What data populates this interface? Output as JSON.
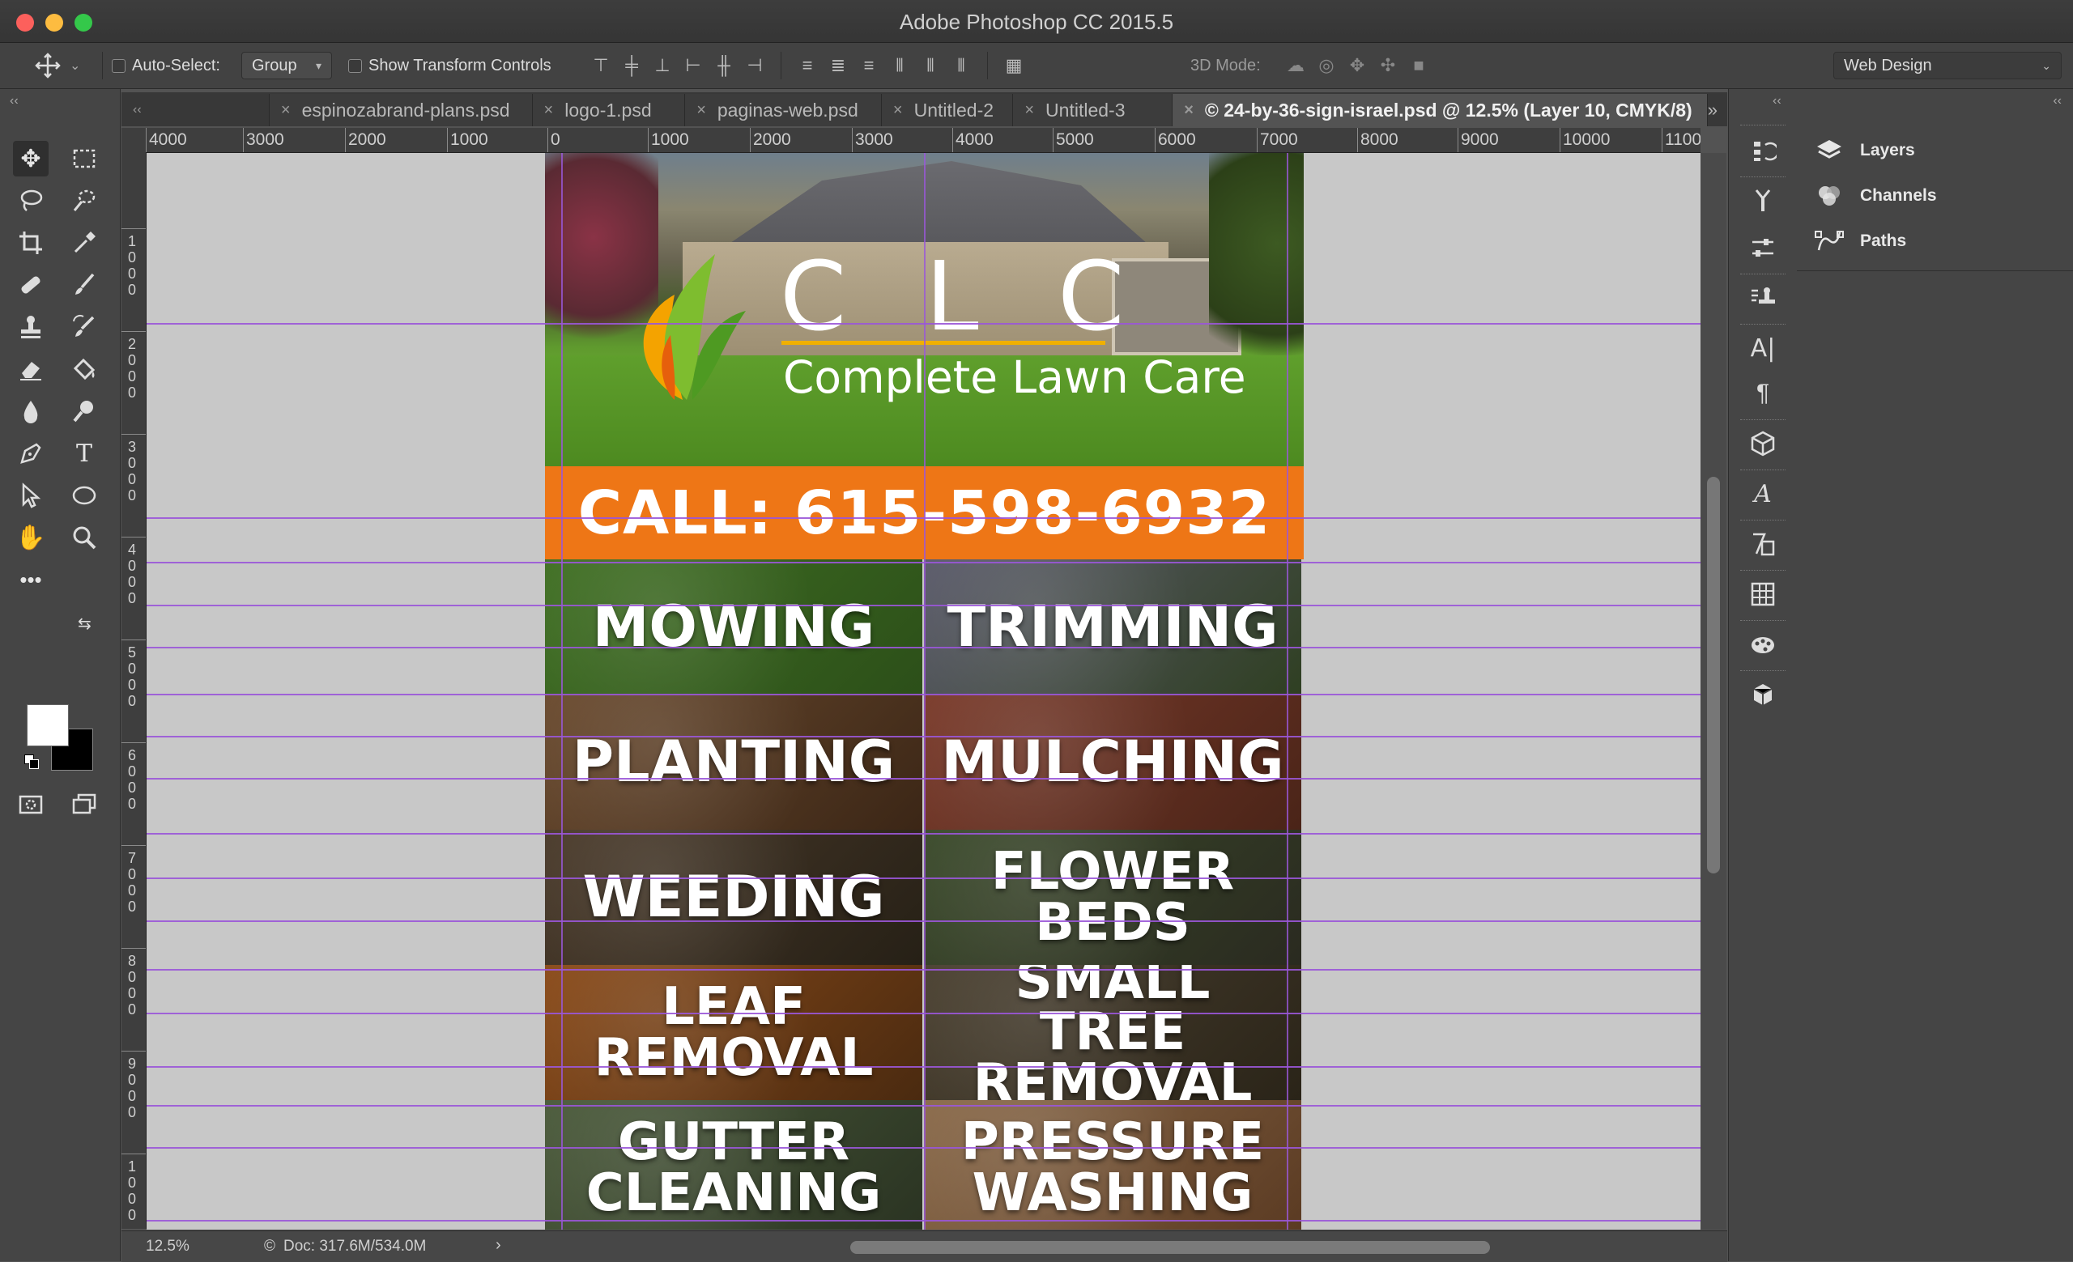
{
  "window": {
    "title": "Adobe Photoshop CC 2015.5"
  },
  "options_bar": {
    "auto_select_label": "Auto-Select:",
    "auto_select_value": "Group",
    "show_transform_label": "Show Transform Controls",
    "mode_3d_label": "3D Mode:",
    "workspace": "Web Design"
  },
  "tabs": [
    {
      "label": "espinozabrand-plans.psd",
      "active": false
    },
    {
      "label": "logo-1.psd",
      "active": false
    },
    {
      "label": "paginas-web.psd",
      "active": false
    },
    {
      "label": "Untitled-2",
      "active": false
    },
    {
      "label": "Untitled-3",
      "active": false
    },
    {
      "label": "© 24-by-36-sign-israel.psd @ 12.5% (Layer 10, CMYK/8)",
      "active": true
    }
  ],
  "ruler_h": [
    "4000",
    "3000",
    "2000",
    "1000",
    "0",
    "1000",
    "2000",
    "3000",
    "4000",
    "5000",
    "6000",
    "7000",
    "8000",
    "9000",
    "10000",
    "1100"
  ],
  "ruler_v": [
    "1000",
    "2000",
    "3000",
    "4000",
    "5000",
    "6000",
    "7000",
    "8000",
    "9000",
    "1000"
  ],
  "document": {
    "logo_letters": "C L C",
    "logo_subtitle": "Complete Lawn Care",
    "call": "CALL: 615-598-6932",
    "services": [
      {
        "label": "MOWING",
        "bg": [
          "#3f6f22",
          "#2c4f19"
        ]
      },
      {
        "label": "TRIMMING",
        "bg": [
          "#5a5a6a",
          "#2f3f22"
        ]
      },
      {
        "label": "PLANTING",
        "bg": [
          "#6a4a2e",
          "#3b2616"
        ]
      },
      {
        "label": "MULCHING",
        "bg": [
          "#7a3a2a",
          "#4a2418"
        ]
      },
      {
        "label": "WEEDING",
        "bg": [
          "#4a3a2a",
          "#262016"
        ]
      },
      {
        "label": "FLOWER BEDS",
        "bg": [
          "#3a4a2a",
          "#2a2a20"
        ]
      },
      {
        "label": "LEAF REMOVAL",
        "bg": [
          "#8a4a18",
          "#4a2a10"
        ]
      },
      {
        "label": "SMALL TREE REMOVAL",
        "bg": [
          "#4a4030",
          "#2a2418"
        ]
      },
      {
        "label": "GUTTER CLEANING",
        "bg": [
          "#4a5a3a",
          "#2a3322"
        ]
      },
      {
        "label": "PRESSURE WASHING",
        "bg": [
          "#8a6a4a",
          "#5a3a22"
        ]
      }
    ]
  },
  "status": {
    "zoom": "12.5%",
    "doc": "Doc: 317.6M/534.0M"
  },
  "panels": [
    {
      "label": "Layers",
      "icon": "layers-icon"
    },
    {
      "label": "Channels",
      "icon": "channels-icon"
    },
    {
      "label": "Paths",
      "icon": "paths-icon"
    }
  ],
  "colors": {
    "accent_orange": "#ee7616",
    "guide": "#9a57d8",
    "logo_gold": "#f0b000"
  }
}
